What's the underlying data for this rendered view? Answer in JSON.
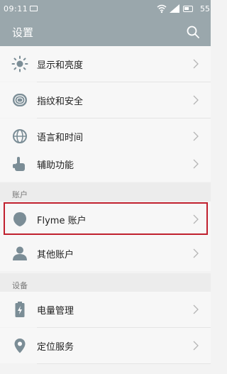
{
  "status_bar": {
    "time": "09:11",
    "battery": "55"
  },
  "header": {
    "title": "设置"
  },
  "sections": {
    "account": "账户",
    "device": "设备"
  },
  "rows": {
    "display": "显示和亮度",
    "fingerprint": "指纹和安全",
    "language": "语言和时间",
    "accessibility": "辅助功能",
    "flyme": "Flyme 账户",
    "other_accounts": "其他账户",
    "battery": "电量管理",
    "location": "定位服务"
  },
  "icons": {
    "display": "brightness-icon",
    "fingerprint": "fingerprint-icon",
    "language": "globe-icon",
    "accessibility": "hand-icon",
    "flyme": "flyme-balloon-icon",
    "other_accounts": "person-icon",
    "battery": "battery-icon",
    "location": "location-pin-icon"
  },
  "colors": {
    "header_bg": "#9aa7ac",
    "highlight": "#c0202e",
    "icon": "#7b8d96"
  }
}
